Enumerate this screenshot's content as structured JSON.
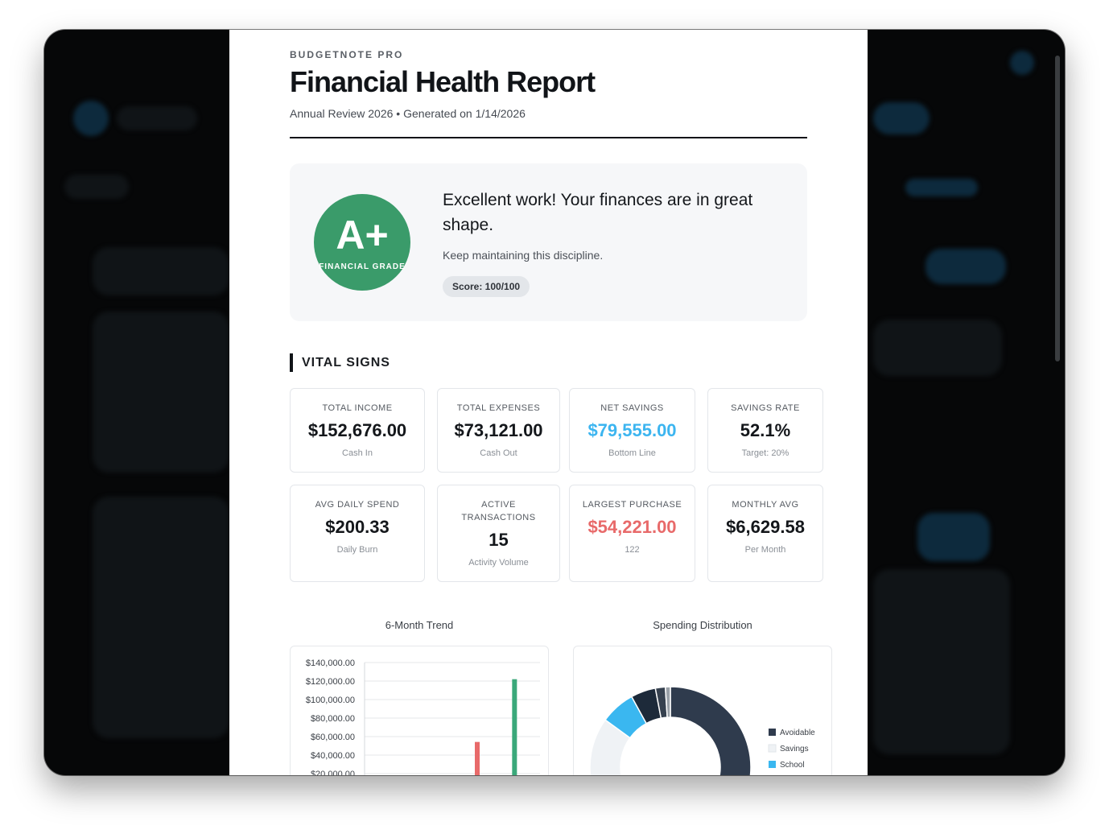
{
  "report": {
    "brand": "BUDGETNOTE PRO",
    "title": "Financial Health Report",
    "subtitle": "Annual Review 2026 • Generated on 1/14/2026"
  },
  "grade": {
    "letter": "A+",
    "label": "FINANCIAL GRADE",
    "message": "Excellent work! Your finances are in great shape.",
    "sub": "Keep maintaining this discipline.",
    "score": "Score: 100/100",
    "color": "#3a9b6a"
  },
  "vital_signs": {
    "heading": "VITAL SIGNS",
    "cards": [
      {
        "label": "TOTAL INCOME",
        "value": "$152,676.00",
        "hint": "Cash In",
        "color": "#14171b"
      },
      {
        "label": "TOTAL EXPENSES",
        "value": "$73,121.00",
        "hint": "Cash Out",
        "color": "#14171b"
      },
      {
        "label": "NET SAVINGS",
        "value": "$79,555.00",
        "hint": "Bottom Line",
        "color": "#3cb5f0"
      },
      {
        "label": "SAVINGS RATE",
        "value": "52.1%",
        "hint": "Target: 20%",
        "color": "#14171b"
      },
      {
        "label": "AVG DAILY SPEND",
        "value": "$200.33",
        "hint": "Daily Burn",
        "color": "#14171b"
      },
      {
        "label": "ACTIVE TRANSACTIONS",
        "value": "15",
        "hint": "Activity Volume",
        "color": "#14171b"
      },
      {
        "label": "LARGEST PURCHASE",
        "value": "$54,221.00",
        "hint": "122",
        "color": "#e86a6a"
      },
      {
        "label": "MONTHLY AVG",
        "value": "$6,629.58",
        "hint": "Per Month",
        "color": "#14171b"
      }
    ]
  },
  "charts": {
    "trend_title": "6-Month Trend",
    "distribution_title": "Spending Distribution"
  },
  "chart_data": [
    {
      "type": "bar",
      "title": "6-Month Trend",
      "ylim": [
        0,
        140000
      ],
      "yticks": [
        "$140,000.00",
        "$120,000.00",
        "$100,000.00",
        "$80,000.00",
        "$60,000.00",
        "$40,000.00",
        "$20,000.00"
      ],
      "ytick_values": [
        140000,
        120000,
        100000,
        80000,
        60000,
        40000,
        20000
      ],
      "series": [
        {
          "values": [
            0,
            0,
            0,
            54221,
            0,
            0
          ],
          "color": "#e86a6a"
        },
        {
          "values": [
            0,
            0,
            0,
            0,
            122000,
            0
          ],
          "color": "#3aa87a"
        }
      ],
      "grid": true
    },
    {
      "type": "pie",
      "title": "Spending Distribution",
      "legend": "right",
      "slices": [
        {
          "name": "Avoidable",
          "value": 55,
          "color": "#2f3b4d"
        },
        {
          "name": "Savings",
          "value": 30,
          "color": "#eff2f5"
        },
        {
          "name": "School",
          "value": 7,
          "color": "#3ab7f0"
        },
        {
          "value": 5,
          "color": "#1d2a3a"
        },
        {
          "value": 2,
          "color": "#36414f"
        },
        {
          "value": 1,
          "color": "#9aa1a8"
        }
      ]
    }
  ]
}
